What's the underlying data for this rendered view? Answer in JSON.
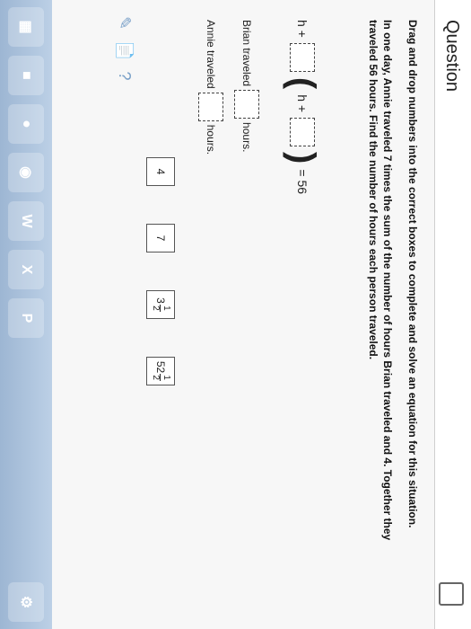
{
  "question": {
    "title": "Question",
    "instruction": "Drag and drop numbers into the correct boxes to complete and solve an equation for this situation.",
    "problem_line1": "In one day, Annie traveled 7 times the sum of the number of hours Brian traveled and 4. Together they",
    "problem_line2": "traveled 56 hours. Find the number of hours each person traveled."
  },
  "equation": {
    "h_plus": "h +",
    "h_plus_inner": "h +",
    "equals": "= 56"
  },
  "answers": {
    "brian_label": "Brian traveled",
    "annie_label": "Annie traveled",
    "hours": "hours."
  },
  "tiles": {
    "t1": "4",
    "t2": "7",
    "t3_whole": "3",
    "t3_num": "1",
    "t3_den": "2",
    "t4_whole": "52",
    "t4_num": "1",
    "t4_den": "2"
  },
  "tools": {
    "help": "?"
  }
}
